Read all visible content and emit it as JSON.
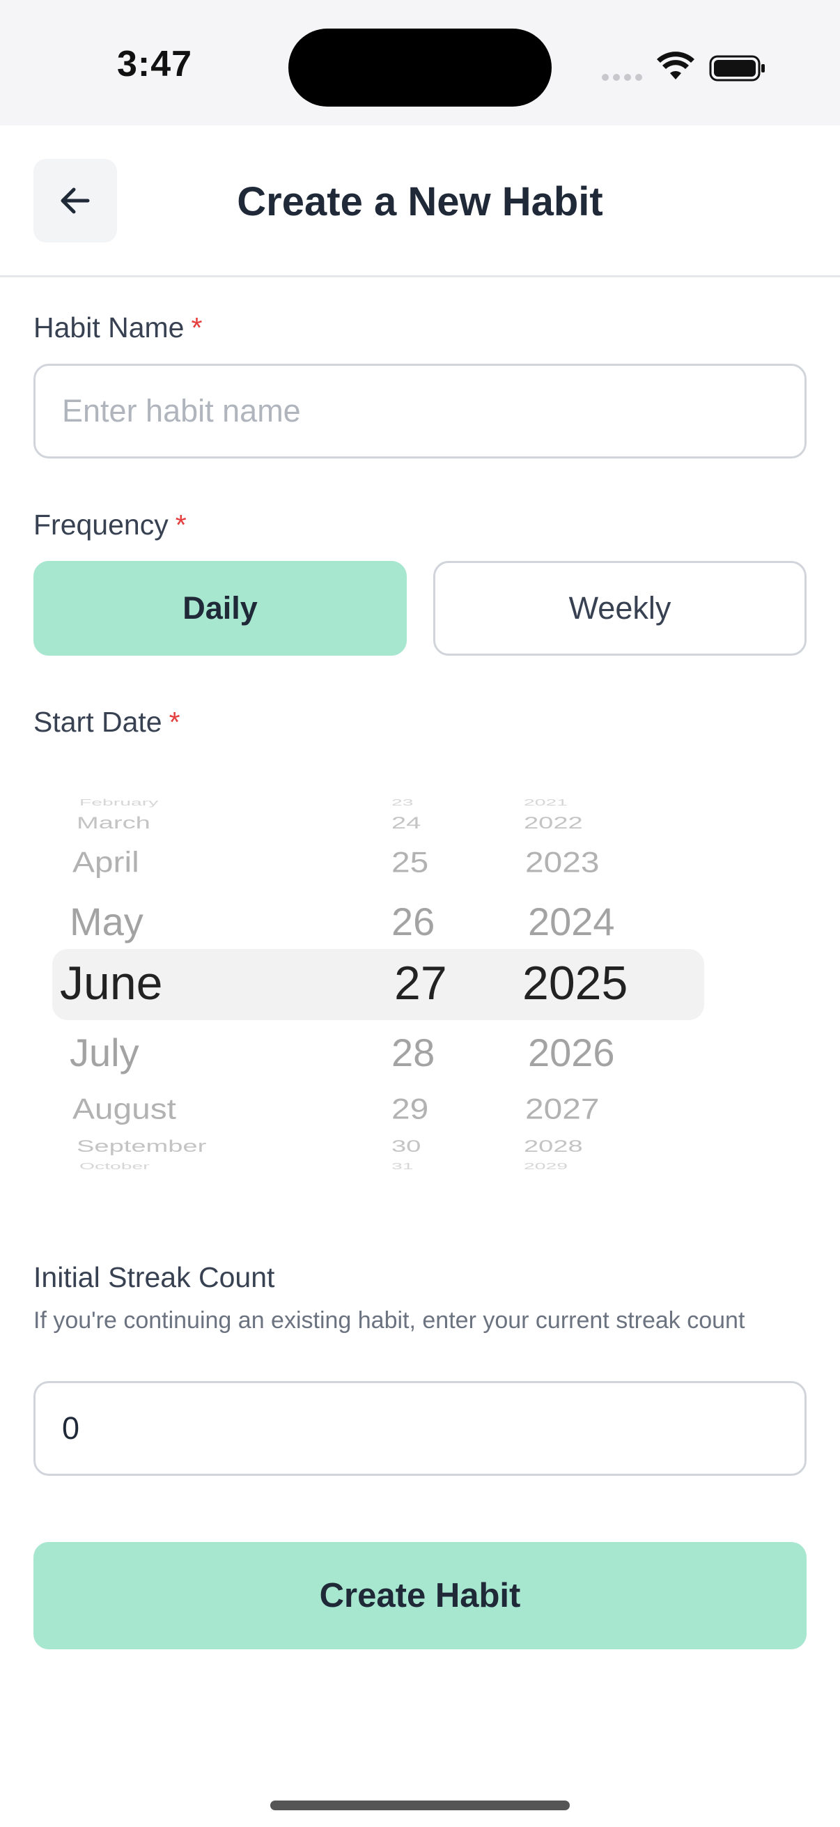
{
  "status_bar": {
    "time": "3:47",
    "icons": [
      "signal-dots-icon",
      "wifi-icon",
      "battery-icon"
    ]
  },
  "header": {
    "back_icon": "arrow-left-icon",
    "title": "Create a New Habit"
  },
  "habit_name": {
    "label": "Habit Name",
    "required_mark": "*",
    "placeholder": "Enter habit name",
    "value": ""
  },
  "frequency": {
    "label": "Frequency",
    "required_mark": "*",
    "options": [
      {
        "label": "Daily",
        "selected": true
      },
      {
        "label": "Weekly",
        "selected": false
      }
    ]
  },
  "start_date": {
    "label": "Start Date",
    "required_mark": "*",
    "months": [
      "February",
      "March",
      "April",
      "May",
      "June",
      "July",
      "August",
      "September",
      "October"
    ],
    "days": [
      "23",
      "24",
      "25",
      "26",
      "27",
      "28",
      "29",
      "30",
      "31"
    ],
    "years": [
      "2021",
      "2022",
      "2023",
      "2024",
      "2025",
      "2026",
      "2027",
      "2028",
      "2029"
    ],
    "selected": {
      "month": "June",
      "day": "27",
      "year": "2025"
    }
  },
  "streak": {
    "label": "Initial Streak Count",
    "hint": "If you're continuing an existing habit, enter your current streak count",
    "value": "0"
  },
  "submit": {
    "label": "Create Habit"
  },
  "colors": {
    "accent": "#a7e6cf",
    "required": "#e53e3e",
    "text": "#1f2937",
    "border": "#d1d5db"
  }
}
